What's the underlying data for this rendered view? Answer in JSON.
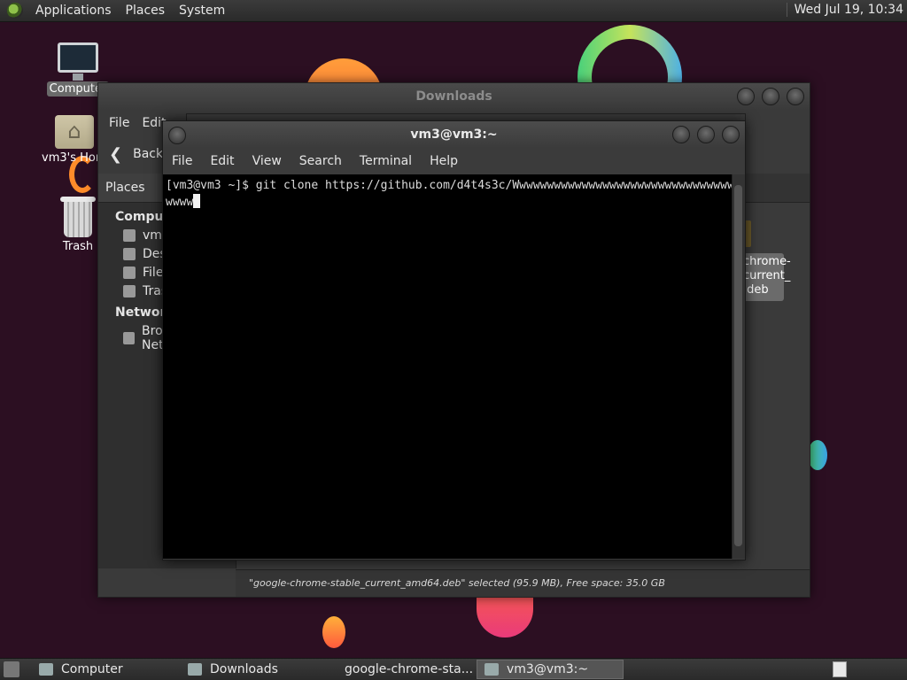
{
  "top_panel": {
    "menus": [
      "Applications",
      "Places",
      "System"
    ],
    "clock": "Wed Jul 19, 10:34"
  },
  "desktop": {
    "icons": [
      {
        "label": "Computer"
      },
      {
        "label": "vm3's Home"
      },
      {
        "label": "Trash"
      }
    ]
  },
  "file_manager": {
    "title": "Downloads",
    "menus": [
      "File",
      "Edit"
    ],
    "toolbar": {
      "back_label": "Back"
    },
    "sidebar": {
      "header": "Places",
      "sections": [
        {
          "title": "Computer",
          "items": [
            "vm3",
            "Desktop",
            "File System",
            "Trash"
          ]
        },
        {
          "title": "Network",
          "items": [
            "Browse Network"
          ]
        }
      ]
    },
    "visible_file_label": "chrome-\ncurrent_\n.deb",
    "status": "\"google-chrome-stable_current_amd64.deb\" selected (95.9 MB), Free space: 35.0 GB"
  },
  "terminal": {
    "title": "vm3@vm3:~",
    "menus": [
      "File",
      "Edit",
      "View",
      "Search",
      "Terminal",
      "Help"
    ],
    "lines": [
      "[vm3@vm3 ~]$ git clone https://github.com/d4t4s3c/Wwwwwwwwwwwwwwwwwwwwwwwwwwwwwwww",
      "wwww"
    ]
  },
  "taskbar": {
    "tasks": [
      {
        "label": "Computer",
        "active": false
      },
      {
        "label": "Downloads",
        "active": false
      },
      {
        "label": "google-chrome-sta...",
        "active": false
      },
      {
        "label": "vm3@vm3:~",
        "active": true
      }
    ]
  }
}
